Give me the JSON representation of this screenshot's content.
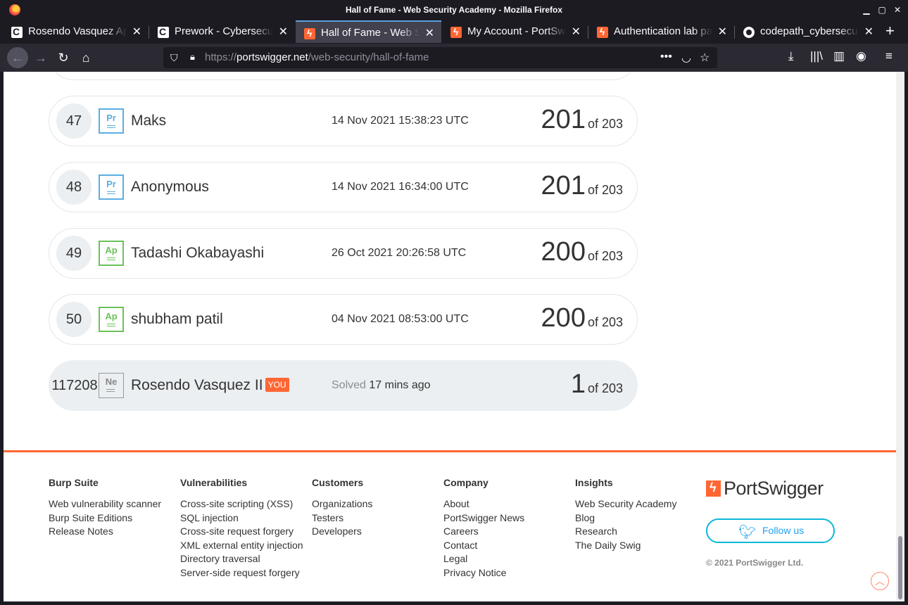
{
  "window": {
    "title": "Hall of Fame - Web Security Academy - Mozilla Firefox",
    "controls": {
      "minimize": "▁",
      "maximize": "▢",
      "close": "✕"
    }
  },
  "tabs": [
    {
      "label": "Rosendo Vasquez App",
      "favicon": "codepath-icon",
      "active": false
    },
    {
      "label": "Prework - Cybersecurity",
      "favicon": "codepath-icon",
      "active": false
    },
    {
      "label": "Hall of Fame - Web Security",
      "favicon": "portswigger-icon",
      "active": true
    },
    {
      "label": "My Account - PortSwigger",
      "favicon": "portswigger-icon",
      "active": false
    },
    {
      "label": "Authentication lab passwords",
      "favicon": "portswigger-icon",
      "active": false
    },
    {
      "label": "codepath_cybersecurity",
      "favicon": "github-icon",
      "active": false
    }
  ],
  "tab_close_glyph": "✕",
  "new_tab_glyph": "+",
  "nav": {
    "back": "←",
    "forward": "→",
    "reload": "↻",
    "home": "⌂",
    "url_protocol": "https://",
    "url_domain": "portswigger.net",
    "url_path": "/web-security/hall-of-fame",
    "more": "•••",
    "pocket": "◡",
    "bookmark": "☆",
    "downloads": "⤓",
    "library": "|||\\",
    "sidebar": "▥",
    "account": "◉",
    "menu": "≡"
  },
  "leaderboard": [
    {
      "rank": "47",
      "badge": "Pr",
      "badge_type": "pr",
      "name": "Maks",
      "date": "14 Nov 2021 15:38:23 UTC",
      "solved": "201",
      "total": "of 203"
    },
    {
      "rank": "48",
      "badge": "Pr",
      "badge_type": "pr",
      "name": "Anonymous",
      "date": "14 Nov 2021 16:34:00 UTC",
      "solved": "201",
      "total": "of 203"
    },
    {
      "rank": "49",
      "badge": "Ap",
      "badge_type": "ap",
      "name": "Tadashi Okabayashi",
      "date": "26 Oct 2021 20:26:58 UTC",
      "solved": "200",
      "total": "of 203"
    },
    {
      "rank": "50",
      "badge": "Ap",
      "badge_type": "ap",
      "name": "shubham patil",
      "date": "04 Nov 2021 08:53:00 UTC",
      "solved": "200",
      "total": "of 203"
    }
  ],
  "you_row": {
    "rank": "117208",
    "badge": "Ne",
    "name": "Rosendo Vasquez II",
    "you_tag": "YOU",
    "solved_prefix": "Solved",
    "solved_time": "17 mins ago",
    "solved": "1",
    "total": "of 203"
  },
  "footer": {
    "columns": [
      {
        "heading": "Burp Suite",
        "links": [
          "Web vulnerability scanner",
          "Burp Suite Editions",
          "Release Notes"
        ]
      },
      {
        "heading": "Vulnerabilities",
        "links": [
          "Cross-site scripting (XSS)",
          "SQL injection",
          "Cross-site request forgery",
          "XML external entity injection",
          "Directory traversal",
          "Server-side request forgery"
        ]
      },
      {
        "heading": "Customers",
        "links": [
          "Organizations",
          "Testers",
          "Developers"
        ]
      },
      {
        "heading": "Company",
        "links": [
          "About",
          "PortSwigger News",
          "Careers",
          "Contact",
          "Legal",
          "Privacy Notice"
        ]
      },
      {
        "heading": "Insights",
        "links": [
          "Web Security Academy",
          "Blog",
          "Research",
          "The Daily Swig"
        ]
      }
    ],
    "brand": "PortSwigger",
    "follow_label": "Follow us",
    "copyright": "© 2021 PortSwigger Ltd.",
    "back_to_top": "︿"
  },
  "colors": {
    "accent": "#ff6633",
    "twitter": "#1da1f2",
    "practitioner": "#5aaee3",
    "apprentice": "#6ac259"
  }
}
